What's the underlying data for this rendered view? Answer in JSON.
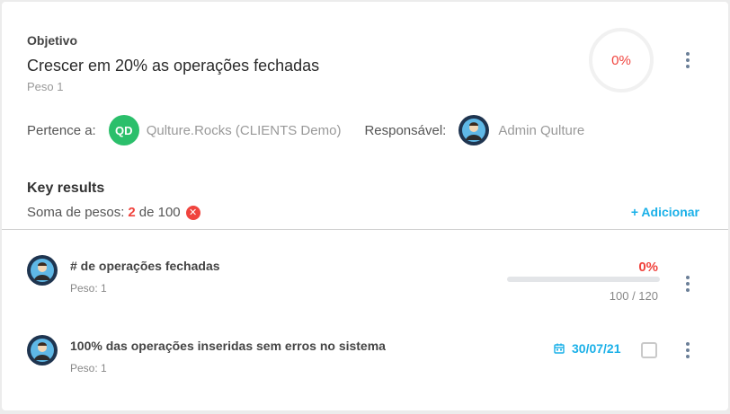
{
  "objective": {
    "label": "Objetivo",
    "title": "Crescer em 20% as operações fechadas",
    "weight": "Peso 1",
    "progress_text": "0%",
    "progress": 0,
    "belongs_label": "Pertence a:",
    "belongs_initials": "QD",
    "belongs_name": "Qulture.Rocks (CLIENTS Demo)",
    "owner_label": "Responsável:",
    "owner_name": "Admin Qulture"
  },
  "key_results": {
    "title": "Key results",
    "sum_prefix": "Soma de pesos:",
    "sum_value": "2",
    "sum_suffix": "de 100",
    "add_label": "+ Adicionar",
    "items": [
      {
        "name": "# de operações fechadas",
        "weight": "Peso: 1",
        "percent_text": "0%",
        "progress": 0,
        "count": "100 / 120"
      },
      {
        "name": "100% das operações inseridas sem erros no sistema",
        "weight": "Peso: 1",
        "date": "30/07/21",
        "checked": false
      }
    ]
  },
  "colors": {
    "accent": "#1ab0e8",
    "danger": "#f0443e",
    "badge_green": "#2bbf6b"
  },
  "icons": [
    "kebab-menu-icon",
    "error-circle-icon",
    "calendar-icon",
    "avatar-icon"
  ]
}
